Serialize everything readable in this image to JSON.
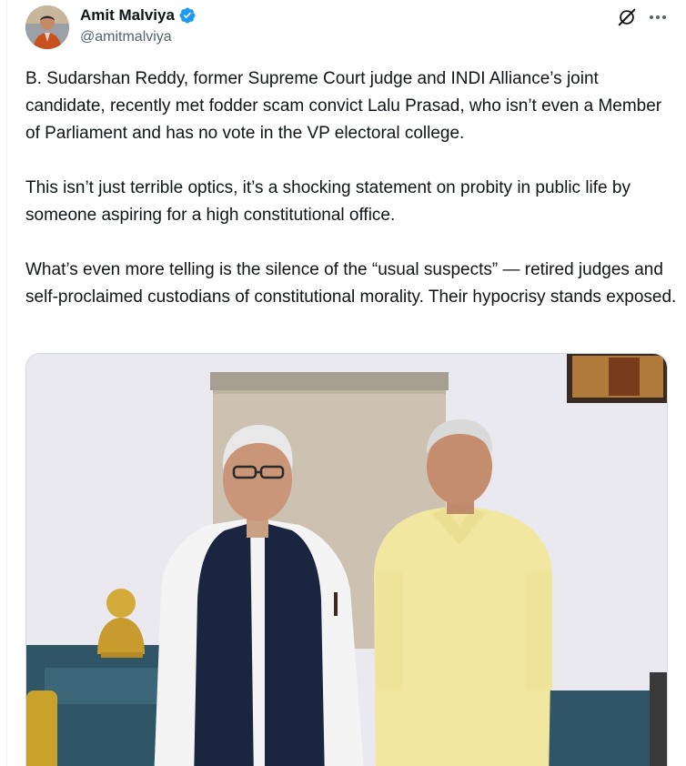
{
  "tweet": {
    "author": {
      "display_name": "Amit Malviya",
      "handle": "@amitmalviya",
      "verified": true,
      "avatar_icon": "profile-photo"
    },
    "paragraphs": [
      "B. Sudarshan Reddy, former Supreme Court judge and INDI Alliance’s joint candidate, recently met fodder scam convict Lalu Prasad, who isn’t even a Member of Parliament and has no vote in the VP electoral college.",
      "This isn’t just terrible optics, it’s a shocking statement on probity in public life by someone aspiring for a high constitutional office.",
      "What’s even more telling is the silence of the “usual suspects” — retired judges and self-proclaimed custodians of constitutional morality. Their hypocrisy stands exposed."
    ],
    "actions": {
      "grok_icon": "grok-icon",
      "more_icon": "more-options-icon"
    },
    "media": {
      "type": "photo",
      "icon": "photo-two-men-standing"
    }
  },
  "colors": {
    "text_primary": "#0f1419",
    "text_secondary": "#536471",
    "verified_blue": "#1d9bf0",
    "border": "#cfd9de"
  }
}
